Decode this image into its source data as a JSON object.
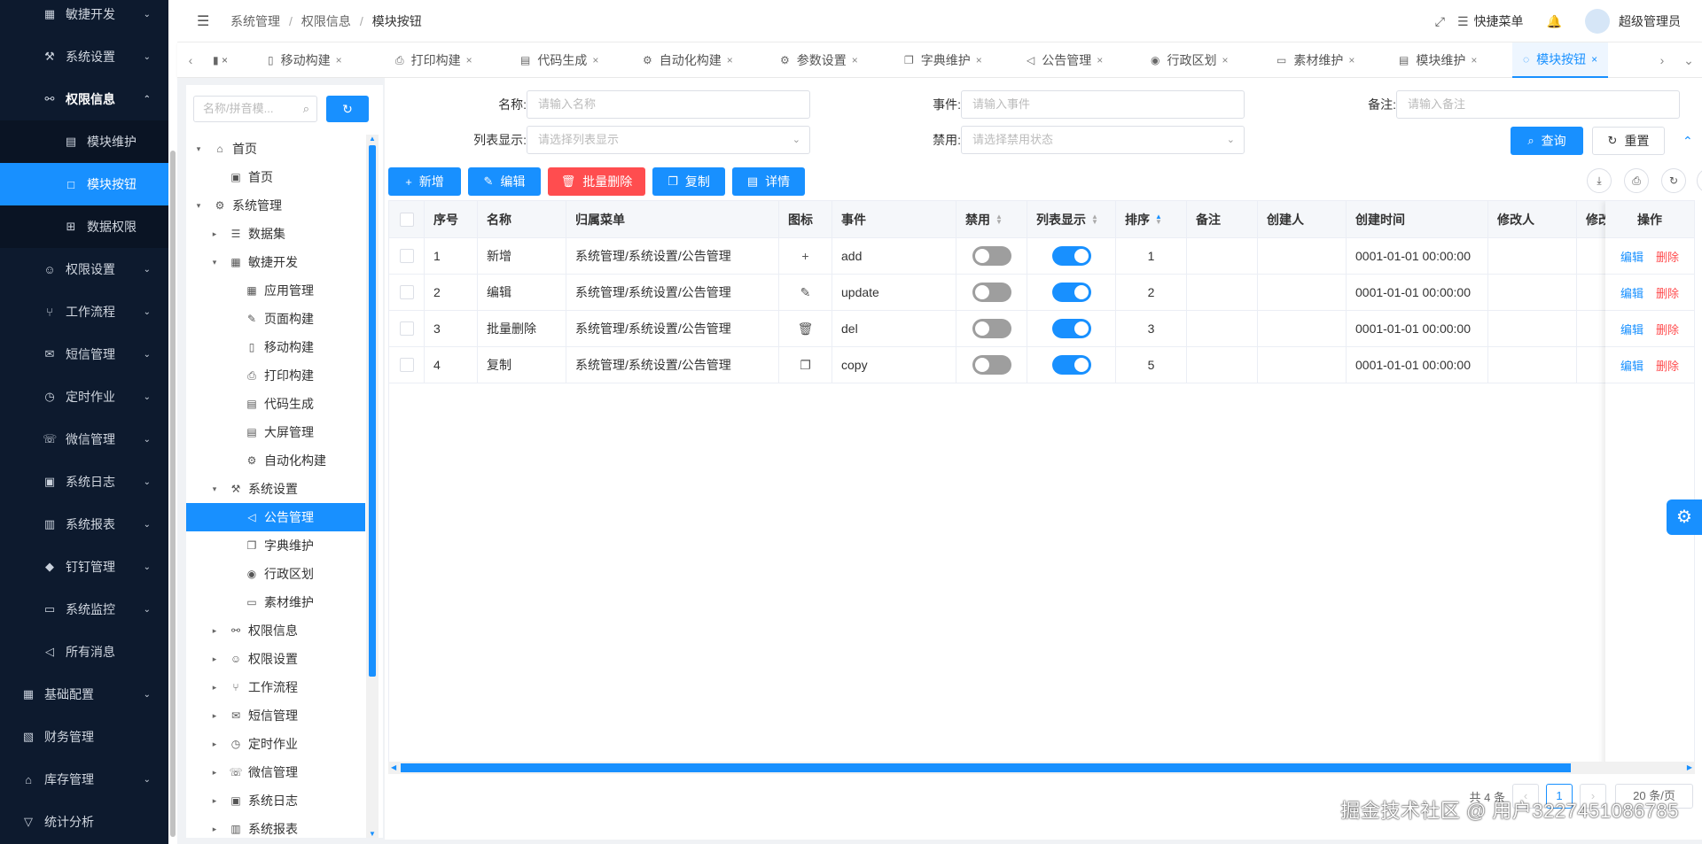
{
  "sidebar": {
    "items": [
      {
        "label": "敏捷开发",
        "icon": "grid-icon",
        "glyph": "▦",
        "chev": "⌄"
      },
      {
        "label": "系统设置",
        "icon": "wrench-icon",
        "glyph": "⚒",
        "chev": "⌄"
      },
      {
        "label": "权限信息",
        "icon": "link-icon",
        "glyph": "⚯",
        "chev": "⌃"
      },
      {
        "label": "模块维护",
        "icon": "list-icon",
        "glyph": "▤"
      },
      {
        "label": "模块按钮",
        "icon": "square-icon",
        "glyph": "□"
      },
      {
        "label": "数据权限",
        "icon": "table-icon",
        "glyph": "⊞"
      },
      {
        "label": "权限设置",
        "icon": "user-icon",
        "glyph": "☺",
        "chev": "⌄"
      },
      {
        "label": "工作流程",
        "icon": "branch-icon",
        "glyph": "⑂",
        "chev": "⌄"
      },
      {
        "label": "短信管理",
        "icon": "message-icon",
        "glyph": "✉",
        "chev": "⌄"
      },
      {
        "label": "定时作业",
        "icon": "clock-icon",
        "glyph": "◷",
        "chev": "⌄"
      },
      {
        "label": "微信管理",
        "icon": "wechat-icon",
        "glyph": "☏",
        "chev": "⌄"
      },
      {
        "label": "系统日志",
        "icon": "terminal-icon",
        "glyph": "▣",
        "chev": "⌄"
      },
      {
        "label": "系统报表",
        "icon": "chart-icon",
        "glyph": "▥",
        "chev": "⌄"
      },
      {
        "label": "钉钉管理",
        "icon": "dingtalk-icon",
        "glyph": "◆",
        "chev": "⌄"
      },
      {
        "label": "系统监控",
        "icon": "monitor-icon",
        "glyph": "▭",
        "chev": "⌄"
      },
      {
        "label": "所有消息",
        "icon": "megaphone-icon",
        "glyph": "◁"
      },
      {
        "label": "基础配置",
        "icon": "grid-icon",
        "glyph": "▦",
        "chev": "⌄"
      },
      {
        "label": "财务管理",
        "icon": "finance-icon",
        "glyph": "▧"
      },
      {
        "label": "库存管理",
        "icon": "bank-icon",
        "glyph": "⌂",
        "chev": "⌄"
      },
      {
        "label": "统计分析",
        "icon": "funnel-icon",
        "glyph": "▽"
      }
    ]
  },
  "header": {
    "breadcrumb": [
      "系统管理",
      "权限信息",
      "模块按钮"
    ],
    "quick_menu": "快捷菜单",
    "username": "超级管理员"
  },
  "tabs": [
    {
      "label": "移动构建",
      "icon": "mobile-icon",
      "glyph": "▯"
    },
    {
      "label": "打印构建",
      "icon": "printer-icon",
      "glyph": "⎙"
    },
    {
      "label": "代码生成",
      "icon": "code-icon",
      "glyph": "▤"
    },
    {
      "label": "自动化构建",
      "icon": "robot-icon",
      "glyph": "⚙"
    },
    {
      "label": "参数设置",
      "icon": "gear-icon",
      "glyph": "⚙"
    },
    {
      "label": "字典维护",
      "icon": "copy-icon",
      "glyph": "❐"
    },
    {
      "label": "公告管理",
      "icon": "megaphone-icon",
      "glyph": "◁"
    },
    {
      "label": "行政区划",
      "icon": "location-icon",
      "glyph": "◉"
    },
    {
      "label": "素材维护",
      "icon": "file-icon",
      "glyph": "▭"
    },
    {
      "label": "模块维护",
      "icon": "list-icon",
      "glyph": "▤"
    },
    {
      "label": "模块按钮",
      "icon": "loading-icon",
      "glyph": "◌"
    }
  ],
  "tree": {
    "search_placeholder": "名称/拼音模...",
    "nodes": [
      {
        "label": "首页",
        "icon": "home-icon",
        "glyph": "⌂",
        "level": 0,
        "arrow": "▾"
      },
      {
        "label": "首页",
        "icon": "calendar-icon",
        "glyph": "▣",
        "level": 1,
        "arrow": ""
      },
      {
        "label": "系统管理",
        "icon": "gear-icon",
        "glyph": "⚙",
        "level": 0,
        "arrow": "▾"
      },
      {
        "label": "数据集",
        "icon": "list-icon",
        "glyph": "☰",
        "level": 1,
        "arrow": "▸"
      },
      {
        "label": "敏捷开发",
        "icon": "grid-icon",
        "glyph": "▦",
        "level": 1,
        "arrow": "▾"
      },
      {
        "label": "应用管理",
        "icon": "apps-icon",
        "glyph": "▦",
        "level": 2,
        "arrow": ""
      },
      {
        "label": "页面构建",
        "icon": "pen-icon",
        "glyph": "✎",
        "level": 2,
        "arrow": ""
      },
      {
        "label": "移动构建",
        "icon": "mobile-icon",
        "glyph": "▯",
        "level": 2,
        "arrow": ""
      },
      {
        "label": "打印构建",
        "icon": "printer-icon",
        "glyph": "⎙",
        "level": 2,
        "arrow": ""
      },
      {
        "label": "代码生成",
        "icon": "code-icon",
        "glyph": "▤",
        "level": 2,
        "arrow": ""
      },
      {
        "label": "大屏管理",
        "icon": "screen-icon",
        "glyph": "▤",
        "level": 2,
        "arrow": ""
      },
      {
        "label": "自动化构建",
        "icon": "robot-icon",
        "glyph": "⚙",
        "level": 2,
        "arrow": ""
      },
      {
        "label": "系统设置",
        "icon": "wrench-icon",
        "glyph": "⚒",
        "level": 1,
        "arrow": "▾"
      },
      {
        "label": "公告管理",
        "icon": "megaphone-icon",
        "glyph": "◁",
        "level": 2,
        "arrow": "",
        "selected": true
      },
      {
        "label": "字典维护",
        "icon": "copy-icon",
        "glyph": "❐",
        "level": 2,
        "arrow": ""
      },
      {
        "label": "行政区划",
        "icon": "location-icon",
        "glyph": "◉",
        "level": 2,
        "arrow": ""
      },
      {
        "label": "素材维护",
        "icon": "file-icon",
        "glyph": "▭",
        "level": 2,
        "arrow": ""
      },
      {
        "label": "权限信息",
        "icon": "link-icon",
        "glyph": "⚯",
        "level": 1,
        "arrow": "▸"
      },
      {
        "label": "权限设置",
        "icon": "user-icon",
        "glyph": "☺",
        "level": 1,
        "arrow": "▸"
      },
      {
        "label": "工作流程",
        "icon": "branch-icon",
        "glyph": "⑂",
        "level": 1,
        "arrow": "▸"
      },
      {
        "label": "短信管理",
        "icon": "message-icon",
        "glyph": "✉",
        "level": 1,
        "arrow": "▸"
      },
      {
        "label": "定时作业",
        "icon": "clock-icon",
        "glyph": "◷",
        "level": 1,
        "arrow": "▸"
      },
      {
        "label": "微信管理",
        "icon": "wechat-icon",
        "glyph": "☏",
        "level": 1,
        "arrow": "▸"
      },
      {
        "label": "系统日志",
        "icon": "terminal-icon",
        "glyph": "▣",
        "level": 1,
        "arrow": "▸"
      },
      {
        "label": "系统报表",
        "icon": "chart-icon",
        "glyph": "▥",
        "level": 1,
        "arrow": "▸"
      }
    ]
  },
  "form": {
    "name_label": "名称:",
    "name_placeholder": "请输入名称",
    "event_label": "事件:",
    "event_placeholder": "请输入事件",
    "remark_label": "备注:",
    "remark_placeholder": "请输入备注",
    "listshow_label": "列表显示:",
    "listshow_placeholder": "请选择列表显示",
    "disable_label": "禁用:",
    "disable_placeholder": "请选择禁用状态",
    "query": "查询",
    "reset": "重置"
  },
  "toolbar": {
    "add": "新增",
    "edit": "编辑",
    "batch_delete": "批量删除",
    "copy": "复制",
    "detail": "详情"
  },
  "table": {
    "columns": [
      "序号",
      "名称",
      "归属菜单",
      "图标",
      "事件",
      "禁用",
      "列表显示",
      "排序",
      "备注",
      "创建人",
      "创建时间",
      "修改人",
      "修改",
      "操作"
    ],
    "rows": [
      {
        "index": "1",
        "name": "新增",
        "menu": "系统管理/系统设置/公告管理",
        "icon": "plus-icon",
        "glyph": "+",
        "event": "add",
        "disabled": false,
        "listshow": true,
        "sort": "1",
        "remark": "",
        "creator": "",
        "created": "0001-01-01 00:00:00",
        "modifier": ""
      },
      {
        "index": "2",
        "name": "编辑",
        "menu": "系统管理/系统设置/公告管理",
        "icon": "edit-icon",
        "glyph": "✎",
        "event": "update",
        "disabled": false,
        "listshow": true,
        "sort": "2",
        "remark": "",
        "creator": "",
        "created": "0001-01-01 00:00:00",
        "modifier": ""
      },
      {
        "index": "3",
        "name": "批量删除",
        "menu": "系统管理/系统设置/公告管理",
        "icon": "trash-icon",
        "glyph": "🗑",
        "event": "del",
        "disabled": false,
        "listshow": true,
        "sort": "3",
        "remark": "",
        "creator": "",
        "created": "0001-01-01 00:00:00",
        "modifier": ""
      },
      {
        "index": "4",
        "name": "复制",
        "menu": "系统管理/系统设置/公告管理",
        "icon": "copy-icon",
        "glyph": "❐",
        "event": "copy",
        "disabled": false,
        "listshow": true,
        "sort": "5",
        "remark": "",
        "creator": "",
        "created": "0001-01-01 00:00:00",
        "modifier": ""
      }
    ],
    "edit_link": "编辑",
    "delete_link": "删除"
  },
  "pager": {
    "total": "共 4 条",
    "current": "1",
    "size": "20 条/页"
  },
  "watermark": "掘金技术社区 @ 用户3227451086785",
  "colors": {
    "primary": "#1890ff",
    "danger": "#ff4d4f",
    "sidebar_bg": "#0d1a2e"
  }
}
